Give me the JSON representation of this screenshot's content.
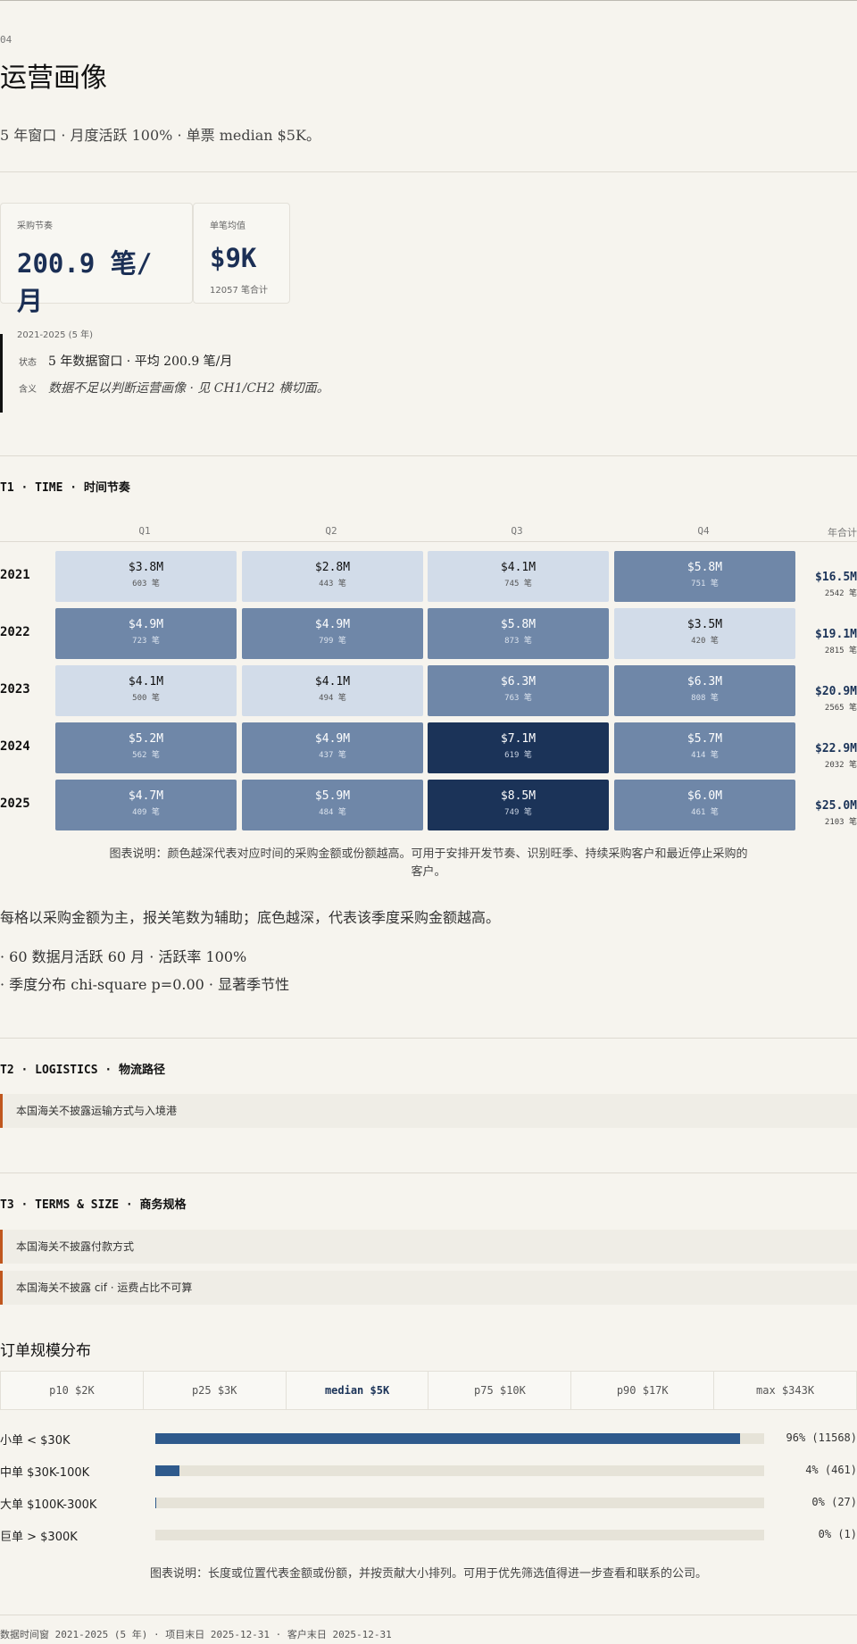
{
  "section": {
    "number": "04",
    "title": "运营画像",
    "subtitle": "5 年窗口 · 月度活跃 100% · 单票 median $5K。"
  },
  "kpis": [
    {
      "label": "采购节奏",
      "value": "200.9 笔/月",
      "note": "2021-2025 (5 年)"
    },
    {
      "label": "单笔均值",
      "value": "$9K",
      "note": "12057 笔合计"
    }
  ],
  "status": {
    "state_key": "状态",
    "state_val": "5 年数据窗口 · 平均 200.9 笔/月",
    "meaning_key": "含义",
    "meaning_val": "数据不足以判断运营画像 · 见 CH1/CH2 横切面。"
  },
  "t1": {
    "heading": "T1 · TIME · 时间节奏",
    "caption": "图表说明：颜色越深代表对应时间的采购金额或份额越高。可用于安排开发节奏、识别旺季、持续采购客户和最近停止采购的客户。",
    "summary": "每格以采购金额为主，报关笔数为辅助；底色越深，代表该季度采购金额越高。",
    "bullets": [
      "· 60 数据月活跃 60 月 · 活跃率 100%",
      "· 季度分布 chi-square p=0.00 · 显著季节性"
    ]
  },
  "chart_data": {
    "type": "heatmap",
    "columns": [
      "Q1",
      "Q2",
      "Q3",
      "Q4"
    ],
    "total_label": "年合计",
    "rows": [
      {
        "year": "2021",
        "cells": [
          {
            "amount": "$3.8M",
            "count": "603 笔",
            "value": 3.8,
            "level": 1
          },
          {
            "amount": "$2.8M",
            "count": "443 笔",
            "value": 2.8,
            "level": 1
          },
          {
            "amount": "$4.1M",
            "count": "745 笔",
            "value": 4.1,
            "level": 1
          },
          {
            "amount": "$5.8M",
            "count": "751 笔",
            "value": 5.8,
            "level": 2
          }
        ],
        "total_amount": "$16.5M",
        "total_count": "2542 笔"
      },
      {
        "year": "2022",
        "cells": [
          {
            "amount": "$4.9M",
            "count": "723 笔",
            "value": 4.9,
            "level": 2
          },
          {
            "amount": "$4.9M",
            "count": "799 笔",
            "value": 4.9,
            "level": 2
          },
          {
            "amount": "$5.8M",
            "count": "873 笔",
            "value": 5.8,
            "level": 2
          },
          {
            "amount": "$3.5M",
            "count": "420 笔",
            "value": 3.5,
            "level": 1
          }
        ],
        "total_amount": "$19.1M",
        "total_count": "2815 笔"
      },
      {
        "year": "2023",
        "cells": [
          {
            "amount": "$4.1M",
            "count": "500 笔",
            "value": 4.1,
            "level": 1
          },
          {
            "amount": "$4.1M",
            "count": "494 笔",
            "value": 4.1,
            "level": 1
          },
          {
            "amount": "$6.3M",
            "count": "763 笔",
            "value": 6.3,
            "level": 2
          },
          {
            "amount": "$6.3M",
            "count": "808 笔",
            "value": 6.3,
            "level": 2
          }
        ],
        "total_amount": "$20.9M",
        "total_count": "2565 笔"
      },
      {
        "year": "2024",
        "cells": [
          {
            "amount": "$5.2M",
            "count": "562 笔",
            "value": 5.2,
            "level": 2
          },
          {
            "amount": "$4.9M",
            "count": "437 笔",
            "value": 4.9,
            "level": 2
          },
          {
            "amount": "$7.1M",
            "count": "619 笔",
            "value": 7.1,
            "level": 3
          },
          {
            "amount": "$5.7M",
            "count": "414 笔",
            "value": 5.7,
            "level": 2
          }
        ],
        "total_amount": "$22.9M",
        "total_count": "2032 笔"
      },
      {
        "year": "2025",
        "cells": [
          {
            "amount": "$4.7M",
            "count": "409 笔",
            "value": 4.7,
            "level": 2
          },
          {
            "amount": "$5.9M",
            "count": "484 笔",
            "value": 5.9,
            "level": 2
          },
          {
            "amount": "$8.5M",
            "count": "749 笔",
            "value": 8.5,
            "level": 3
          },
          {
            "amount": "$6.0M",
            "count": "461 笔",
            "value": 6.0,
            "level": 2
          }
        ],
        "total_amount": "$25.0M",
        "total_count": "2103 笔"
      }
    ]
  },
  "t2": {
    "heading": "T2 · LOGISTICS · 物流路径",
    "notes": [
      "本国海关不披露运输方式与入境港"
    ]
  },
  "t3": {
    "heading": "T3 · TERMS & SIZE · 商务规格",
    "notes": [
      "本国海关不披露付款方式",
      "本国海关不披露 cif · 运费占比不可算"
    ]
  },
  "order_size": {
    "title": "订单规模分布",
    "percentiles": [
      "p10 $2K",
      "p25 $3K",
      "median $5K",
      "p75 $10K",
      "p90 $17K",
      "max $343K"
    ],
    "bars": [
      {
        "label": "小单 < $30K",
        "pct": 96,
        "value": "96% (11568)"
      },
      {
        "label": "中单 $30K-100K",
        "pct": 4,
        "value": "4% (461)"
      },
      {
        "label": "大单 $100K-300K",
        "pct": 0.2,
        "value": "0% (27)"
      },
      {
        "label": "巨单 > $300K",
        "pct": 0,
        "value": "0% (1)"
      }
    ],
    "caption": "图表说明：长度或位置代表金额或份额，并按贡献大小排列。可用于优先筛选值得进一步查看和联系的公司。"
  },
  "footer": "数据时间窗 2021-2025 (5 年) · 项目末日 2025-12-31 · 客户末日 2025-12-31"
}
